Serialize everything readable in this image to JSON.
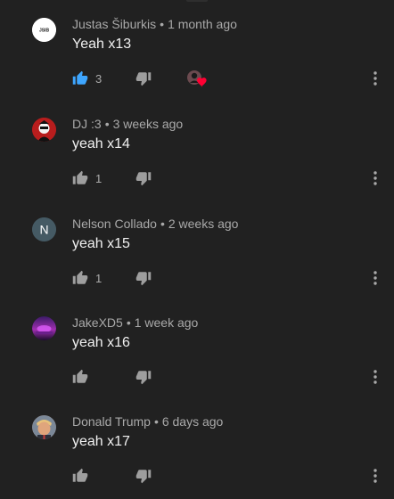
{
  "comments": [
    {
      "author": "Justas Šiburkis",
      "time": "1 month ago",
      "text": "Yeah x13",
      "likes": "3",
      "like_active": true,
      "creator_heart": true,
      "avatar_text": "JSIB",
      "avatar_icon": "logo-avatar"
    },
    {
      "author": "DJ :3",
      "time": "3 weeks ago",
      "text": "yeah x14",
      "likes": "1",
      "like_active": false,
      "creator_heart": false,
      "avatar_icon": "character-avatar"
    },
    {
      "author": "Nelson Collado",
      "time": "2 weeks ago",
      "text": "yeah x15",
      "likes": "1",
      "like_active": false,
      "creator_heart": false,
      "avatar_text": "N",
      "avatar_icon": "letter-avatar"
    },
    {
      "author": "JakeXD5",
      "time": "1 week ago",
      "text": "yeah x16",
      "likes": "",
      "like_active": false,
      "creator_heart": false,
      "avatar_icon": "neon-avatar"
    },
    {
      "author": "Donald Trump",
      "time": "6 days ago",
      "text": "yeah x17",
      "likes": "",
      "like_active": false,
      "creator_heart": false,
      "avatar_icon": "photo-avatar"
    }
  ],
  "meta_separator": "•",
  "colors": {
    "background": "#212121",
    "meta_text": "#a9a9a9",
    "body_text": "#f1f1f1",
    "icon_gray": "#9e9e9e",
    "like_active": "#3ea6ff",
    "heart": "#ff0033"
  },
  "icons": {
    "like": "thumbs-up-icon",
    "dislike": "thumbs-down-icon",
    "more": "more-vert-icon",
    "creator_heart": "creator-heart-icon"
  }
}
